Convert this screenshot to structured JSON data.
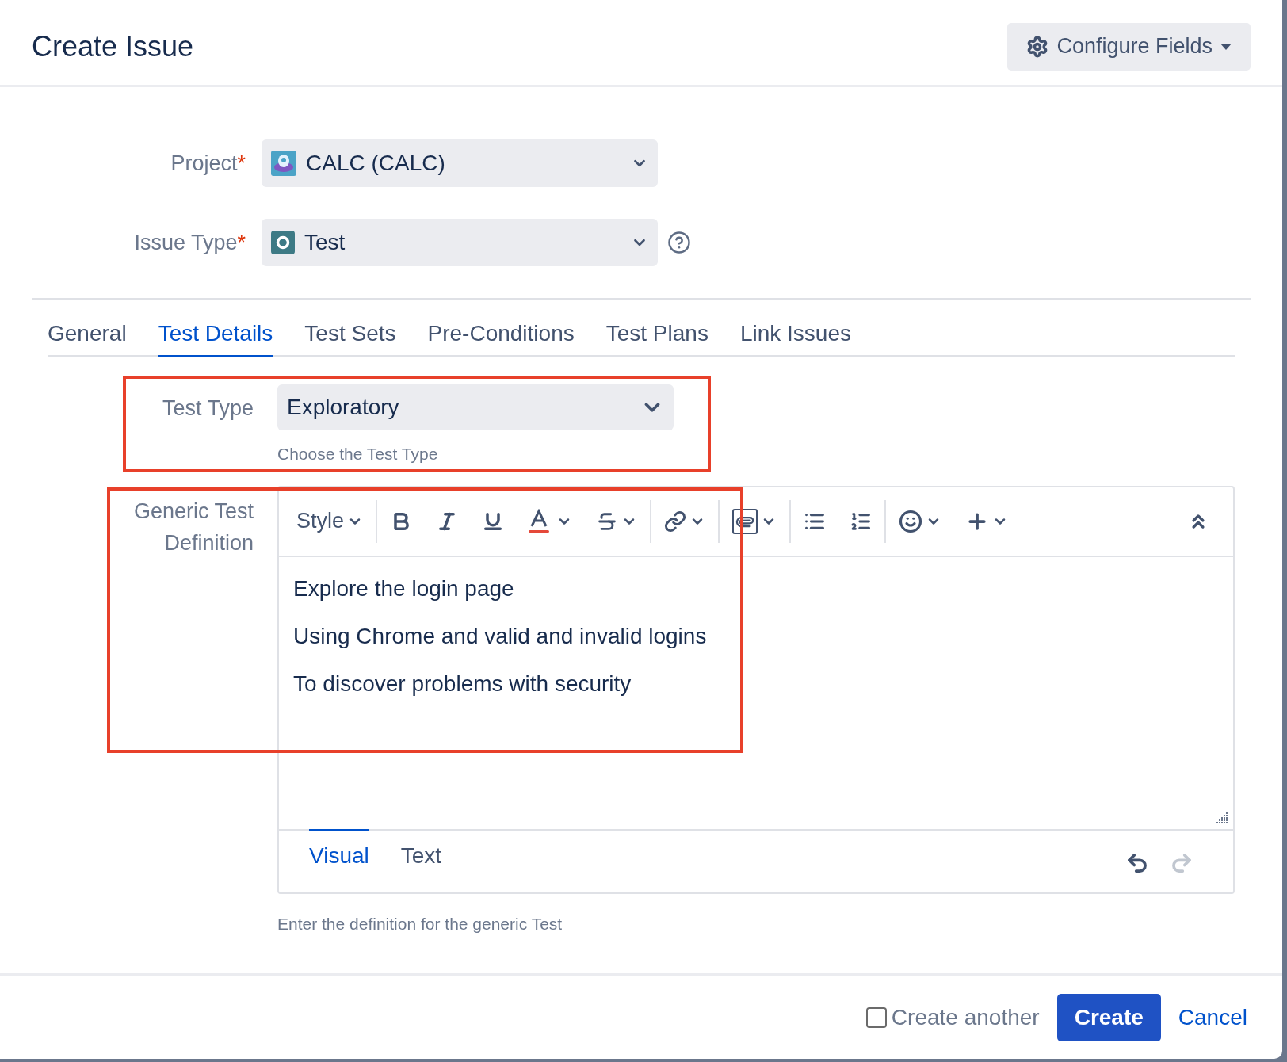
{
  "dialog": {
    "title": "Create Issue",
    "configure_button": "Configure Fields"
  },
  "fields": [
    {
      "label": "Project",
      "required_mark": "*",
      "value": "CALC (CALC)",
      "kind": "project",
      "help": false
    },
    {
      "label": "Issue Type",
      "required_mark": "*",
      "value": "Test",
      "kind": "issuetype",
      "help": true
    }
  ],
  "tabs": [
    {
      "label": "General",
      "selected": false
    },
    {
      "label": "Test Details",
      "selected": true
    },
    {
      "label": "Test Sets",
      "selected": false
    },
    {
      "label": "Pre-Conditions",
      "selected": false
    },
    {
      "label": "Test Plans",
      "selected": false
    },
    {
      "label": "Link Issues",
      "selected": false
    }
  ],
  "test_type": {
    "label": "Test Type",
    "value": "Exploratory",
    "hint": "Choose the Test Type"
  },
  "definition": {
    "label": "Generic Test Definition",
    "toolbar_style": "Style",
    "lines": [
      "Explore the login page",
      "Using Chrome and valid and invalid logins",
      "To discover problems with security"
    ],
    "mode_tabs": [
      {
        "label": "Visual",
        "selected": true
      },
      {
        "label": "Text",
        "selected": false
      }
    ],
    "history": [
      {
        "kind": "undo",
        "disabled": false
      },
      {
        "kind": "redo",
        "disabled": true
      }
    ],
    "hint": "Enter the definition for the generic Test"
  },
  "footer": {
    "create_another": {
      "label": "Create another",
      "checked": false
    },
    "create_button": "Create",
    "cancel_link": "Cancel"
  }
}
